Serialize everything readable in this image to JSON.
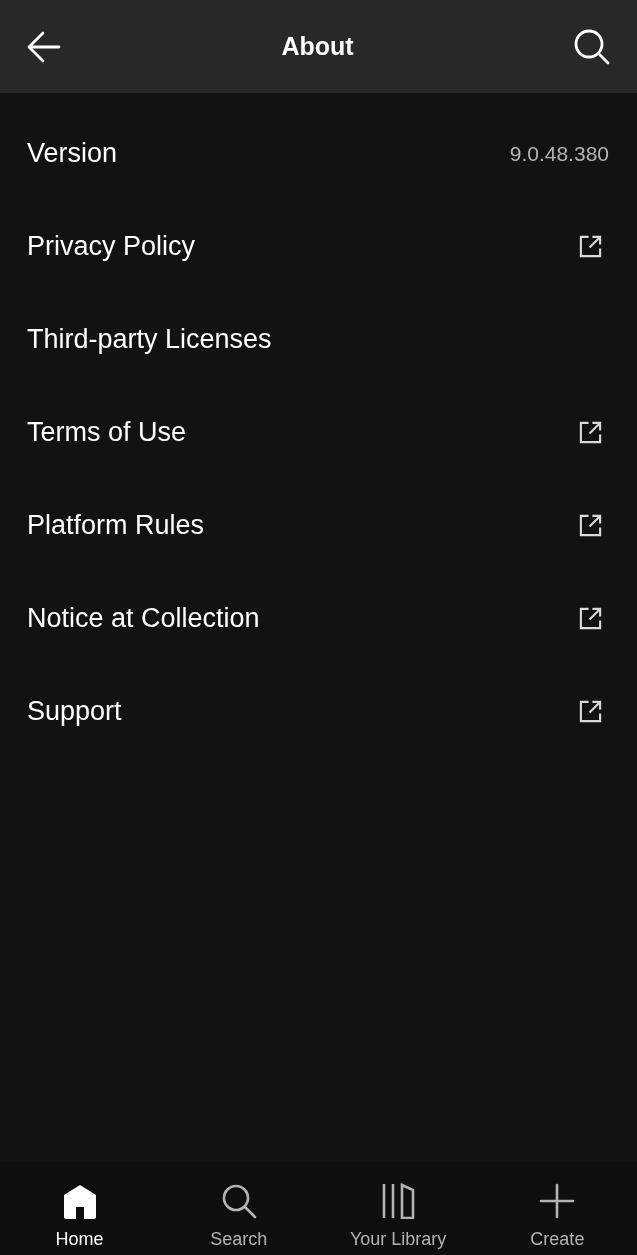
{
  "header": {
    "title": "About"
  },
  "rows": [
    {
      "kind": "value",
      "label": "Version",
      "value": "9.0.48.380"
    },
    {
      "kind": "external",
      "label": "Privacy Policy"
    },
    {
      "kind": "plain",
      "label": "Third-party Licenses"
    },
    {
      "kind": "external",
      "label": "Terms of Use"
    },
    {
      "kind": "external",
      "label": "Platform Rules"
    },
    {
      "kind": "external",
      "label": "Notice at Collection"
    },
    {
      "kind": "external",
      "label": "Support"
    }
  ],
  "nav": [
    {
      "label": "Home",
      "selected": true
    },
    {
      "label": "Search",
      "selected": false
    },
    {
      "label": "Your Library",
      "selected": false
    },
    {
      "label": "Create",
      "selected": false
    }
  ]
}
